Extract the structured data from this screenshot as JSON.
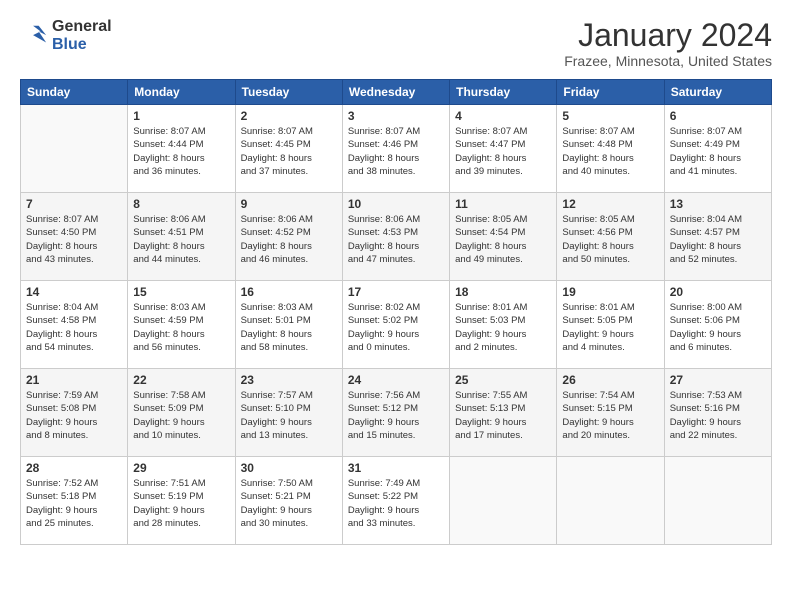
{
  "header": {
    "logo_general": "General",
    "logo_blue": "Blue",
    "title": "January 2024",
    "location": "Frazee, Minnesota, United States"
  },
  "days_of_week": [
    "Sunday",
    "Monday",
    "Tuesday",
    "Wednesday",
    "Thursday",
    "Friday",
    "Saturday"
  ],
  "weeks": [
    [
      {
        "day": "",
        "info": ""
      },
      {
        "day": "1",
        "info": "Sunrise: 8:07 AM\nSunset: 4:44 PM\nDaylight: 8 hours\nand 36 minutes."
      },
      {
        "day": "2",
        "info": "Sunrise: 8:07 AM\nSunset: 4:45 PM\nDaylight: 8 hours\nand 37 minutes."
      },
      {
        "day": "3",
        "info": "Sunrise: 8:07 AM\nSunset: 4:46 PM\nDaylight: 8 hours\nand 38 minutes."
      },
      {
        "day": "4",
        "info": "Sunrise: 8:07 AM\nSunset: 4:47 PM\nDaylight: 8 hours\nand 39 minutes."
      },
      {
        "day": "5",
        "info": "Sunrise: 8:07 AM\nSunset: 4:48 PM\nDaylight: 8 hours\nand 40 minutes."
      },
      {
        "day": "6",
        "info": "Sunrise: 8:07 AM\nSunset: 4:49 PM\nDaylight: 8 hours\nand 41 minutes."
      }
    ],
    [
      {
        "day": "7",
        "info": "Sunrise: 8:07 AM\nSunset: 4:50 PM\nDaylight: 8 hours\nand 43 minutes."
      },
      {
        "day": "8",
        "info": "Sunrise: 8:06 AM\nSunset: 4:51 PM\nDaylight: 8 hours\nand 44 minutes."
      },
      {
        "day": "9",
        "info": "Sunrise: 8:06 AM\nSunset: 4:52 PM\nDaylight: 8 hours\nand 46 minutes."
      },
      {
        "day": "10",
        "info": "Sunrise: 8:06 AM\nSunset: 4:53 PM\nDaylight: 8 hours\nand 47 minutes."
      },
      {
        "day": "11",
        "info": "Sunrise: 8:05 AM\nSunset: 4:54 PM\nDaylight: 8 hours\nand 49 minutes."
      },
      {
        "day": "12",
        "info": "Sunrise: 8:05 AM\nSunset: 4:56 PM\nDaylight: 8 hours\nand 50 minutes."
      },
      {
        "day": "13",
        "info": "Sunrise: 8:04 AM\nSunset: 4:57 PM\nDaylight: 8 hours\nand 52 minutes."
      }
    ],
    [
      {
        "day": "14",
        "info": "Sunrise: 8:04 AM\nSunset: 4:58 PM\nDaylight: 8 hours\nand 54 minutes."
      },
      {
        "day": "15",
        "info": "Sunrise: 8:03 AM\nSunset: 4:59 PM\nDaylight: 8 hours\nand 56 minutes."
      },
      {
        "day": "16",
        "info": "Sunrise: 8:03 AM\nSunset: 5:01 PM\nDaylight: 8 hours\nand 58 minutes."
      },
      {
        "day": "17",
        "info": "Sunrise: 8:02 AM\nSunset: 5:02 PM\nDaylight: 9 hours\nand 0 minutes."
      },
      {
        "day": "18",
        "info": "Sunrise: 8:01 AM\nSunset: 5:03 PM\nDaylight: 9 hours\nand 2 minutes."
      },
      {
        "day": "19",
        "info": "Sunrise: 8:01 AM\nSunset: 5:05 PM\nDaylight: 9 hours\nand 4 minutes."
      },
      {
        "day": "20",
        "info": "Sunrise: 8:00 AM\nSunset: 5:06 PM\nDaylight: 9 hours\nand 6 minutes."
      }
    ],
    [
      {
        "day": "21",
        "info": "Sunrise: 7:59 AM\nSunset: 5:08 PM\nDaylight: 9 hours\nand 8 minutes."
      },
      {
        "day": "22",
        "info": "Sunrise: 7:58 AM\nSunset: 5:09 PM\nDaylight: 9 hours\nand 10 minutes."
      },
      {
        "day": "23",
        "info": "Sunrise: 7:57 AM\nSunset: 5:10 PM\nDaylight: 9 hours\nand 13 minutes."
      },
      {
        "day": "24",
        "info": "Sunrise: 7:56 AM\nSunset: 5:12 PM\nDaylight: 9 hours\nand 15 minutes."
      },
      {
        "day": "25",
        "info": "Sunrise: 7:55 AM\nSunset: 5:13 PM\nDaylight: 9 hours\nand 17 minutes."
      },
      {
        "day": "26",
        "info": "Sunrise: 7:54 AM\nSunset: 5:15 PM\nDaylight: 9 hours\nand 20 minutes."
      },
      {
        "day": "27",
        "info": "Sunrise: 7:53 AM\nSunset: 5:16 PM\nDaylight: 9 hours\nand 22 minutes."
      }
    ],
    [
      {
        "day": "28",
        "info": "Sunrise: 7:52 AM\nSunset: 5:18 PM\nDaylight: 9 hours\nand 25 minutes."
      },
      {
        "day": "29",
        "info": "Sunrise: 7:51 AM\nSunset: 5:19 PM\nDaylight: 9 hours\nand 28 minutes."
      },
      {
        "day": "30",
        "info": "Sunrise: 7:50 AM\nSunset: 5:21 PM\nDaylight: 9 hours\nand 30 minutes."
      },
      {
        "day": "31",
        "info": "Sunrise: 7:49 AM\nSunset: 5:22 PM\nDaylight: 9 hours\nand 33 minutes."
      },
      {
        "day": "",
        "info": ""
      },
      {
        "day": "",
        "info": ""
      },
      {
        "day": "",
        "info": ""
      }
    ]
  ]
}
